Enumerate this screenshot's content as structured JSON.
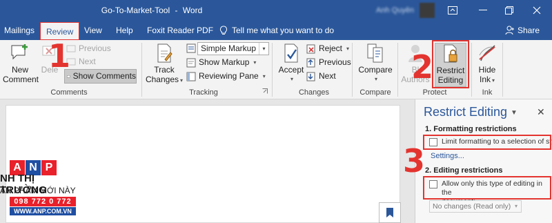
{
  "window": {
    "doc_name": "Go-To-Market-Tool",
    "separator": "-",
    "app_name": "Word",
    "user_name": "Anh Quyên"
  },
  "tabs": [
    {
      "label": "Mailings"
    },
    {
      "label": "Review",
      "active": true
    },
    {
      "label": "View"
    },
    {
      "label": "Help"
    },
    {
      "label": "Foxit Reader PDF"
    }
  ],
  "tell_me": "Tell me what you want to do",
  "share": "Share",
  "ribbon": {
    "comments": {
      "new_comment_line1": "New",
      "new_comment_line2": "Comment",
      "delete": "Dele",
      "previous": "Previous",
      "next": "Next",
      "show_comments": "Show Comments",
      "group_label": "Comments"
    },
    "tracking": {
      "track_changes_line1": "Track",
      "track_changes_line2": "Changes",
      "markup_value": "Simple Markup",
      "show_markup": "Show Markup",
      "reviewing_pane": "Reviewing Pane",
      "group_label": "Tracking"
    },
    "changes": {
      "accept": "Accept",
      "reject": "Reject",
      "previous": "Previous",
      "next": "Next",
      "group_label": "Changes"
    },
    "compare": {
      "compare": "Compare",
      "group_label": "Compare"
    },
    "protect": {
      "block_authors_line1": "Bl",
      "block_authors_line2": "Authors",
      "restrict_editing_line1": "Restrict",
      "restrict_editing_line2": "Editing",
      "group_label": "Protect"
    },
    "ink": {
      "hide_ink_line1": "Hide",
      "hide_ink_line2": "Ink",
      "group_label": "Ink"
    }
  },
  "pane": {
    "title": "Restrict Editing",
    "section1": "1. Formatting restrictions",
    "limit_formatting": "Limit formatting to a selection of styles",
    "settings_link": "Settings...",
    "section2": "2. Editing restrictions",
    "allow_only_line1": "Allow only this type of editing in the",
    "allow_only_line2": "document:",
    "editing_type": "No changes (Read only)"
  },
  "steps": [
    "1",
    "2",
    "3"
  ],
  "watermark": {
    "letters": [
      "A",
      "N",
      "P"
    ],
    "line1": "NH THỊ TRƯỜNG",
    "line2": "ẢN PHẨM MỚI NÀY",
    "phone": "098 772 0 772",
    "website": "WWW.ANP.COM.VN"
  },
  "colors": {
    "word_blue": "#2b579a",
    "annotation_red": "#e3342f",
    "ribbon_bg": "#f3f3f3"
  }
}
